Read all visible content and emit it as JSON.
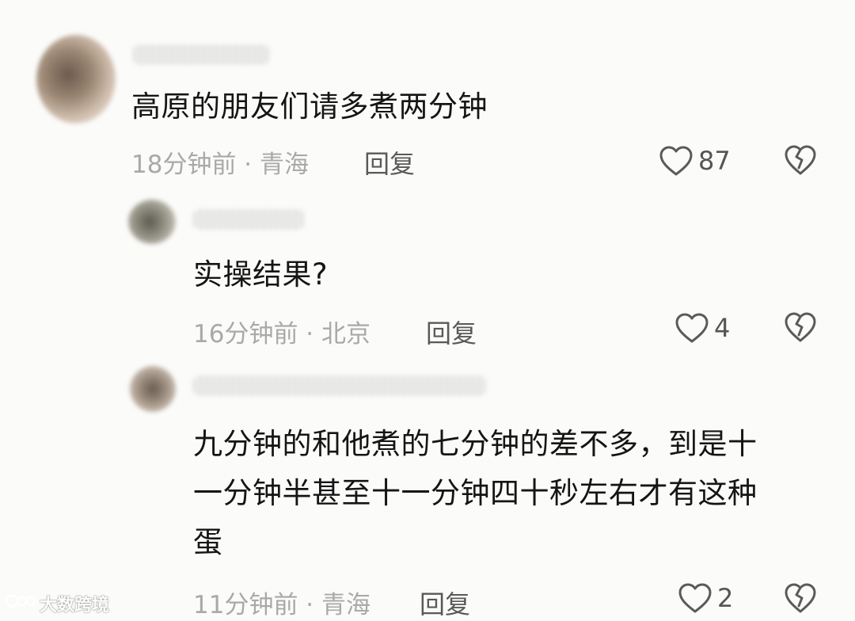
{
  "comments": [
    {
      "text": "高原的朋友们请多煮两分钟",
      "time": "18分钟前",
      "location": "青海",
      "reply_label": "回复",
      "likes": "87"
    },
    {
      "text": "实操结果?",
      "time": "16分钟前",
      "location": "北京",
      "reply_label": "回复",
      "likes": "4"
    },
    {
      "text_lines": [
        "九分钟的和他煮的七分钟的差不多，到是十",
        "一分钟半甚至十一分钟四十秒左右才有这种",
        "蛋"
      ],
      "time": "11分钟前",
      "location": "青海",
      "reply_label": "回复",
      "likes": "2"
    }
  ],
  "meta_separator": " · ",
  "watermark": {
    "text": "大数跨境"
  },
  "colors": {
    "background": "#fbfbf9",
    "text": "#151515",
    "meta": "#a9a9a9",
    "icon": "#595959"
  }
}
